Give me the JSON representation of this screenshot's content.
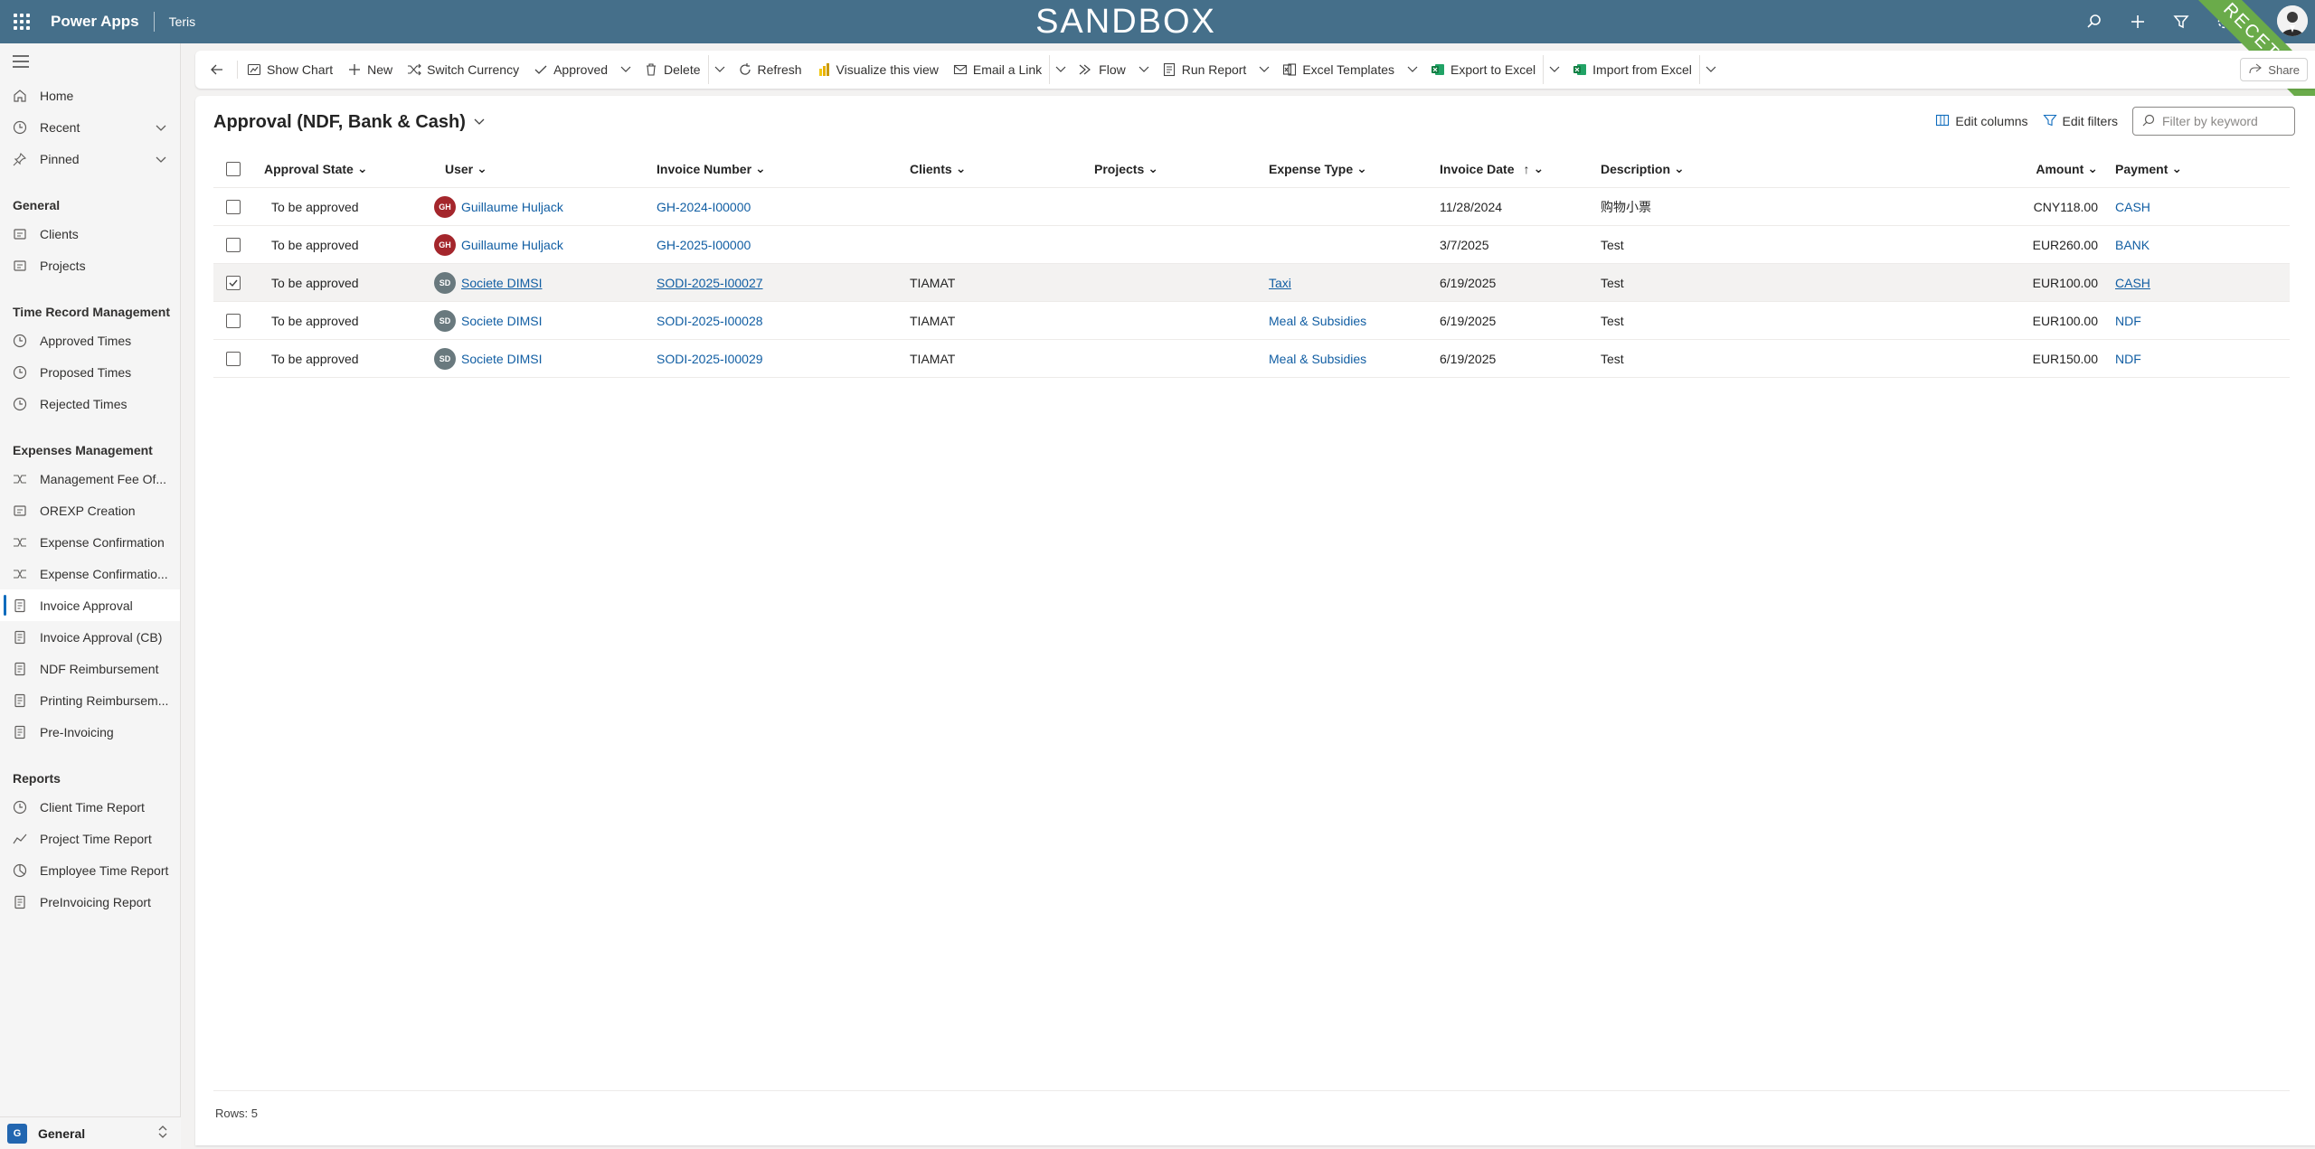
{
  "header": {
    "app_name": "Power Apps",
    "environment": "Teris",
    "banner": "SANDBOX",
    "ribbon": "RECETTE"
  },
  "sidebar": {
    "top_items": [
      {
        "label": "Home",
        "icon": "home-icon"
      },
      {
        "label": "Recent",
        "icon": "clock-icon",
        "expandable": true
      },
      {
        "label": "Pinned",
        "icon": "pin-icon",
        "expandable": true
      }
    ],
    "groups": [
      {
        "title": "General",
        "items": [
          {
            "label": "Clients",
            "icon": "document-icon"
          },
          {
            "label": "Projects",
            "icon": "document-icon"
          }
        ]
      },
      {
        "title": "Time Record Management",
        "items": [
          {
            "label": "Approved Times",
            "icon": "clock-icon"
          },
          {
            "label": "Proposed Times",
            "icon": "clock-icon"
          },
          {
            "label": "Rejected Times",
            "icon": "clock-icon"
          }
        ]
      },
      {
        "title": "Expenses Management",
        "items": [
          {
            "label": "Management Fee Of...",
            "icon": "flow-icon"
          },
          {
            "label": "OREXP Creation",
            "icon": "document-icon"
          },
          {
            "label": "Expense Confirmation",
            "icon": "flow-icon"
          },
          {
            "label": "Expense Confirmatio...",
            "icon": "flow-icon"
          },
          {
            "label": "Invoice Approval",
            "icon": "receipt-icon",
            "active": true
          },
          {
            "label": "Invoice Approval (CB)",
            "icon": "receipt-icon"
          },
          {
            "label": "NDF Reimbursement",
            "icon": "receipt-icon"
          },
          {
            "label": "Printing Reimbursem...",
            "icon": "receipt-icon"
          },
          {
            "label": "Pre-Invoicing",
            "icon": "receipt-icon"
          }
        ]
      },
      {
        "title": "Reports",
        "items": [
          {
            "label": "Client Time Report",
            "icon": "clock-icon"
          },
          {
            "label": "Project Time Report",
            "icon": "chart-line-icon"
          },
          {
            "label": "Employee Time Report",
            "icon": "pie-icon"
          },
          {
            "label": "PreInvoicing Report",
            "icon": "receipt-icon"
          }
        ]
      }
    ],
    "area": {
      "badge": "G",
      "label": "General"
    }
  },
  "commands": {
    "show_chart": "Show Chart",
    "new": "New",
    "switch_currency": "Switch Currency",
    "approved": "Approved",
    "delete": "Delete",
    "refresh": "Refresh",
    "visualize": "Visualize this view",
    "email_link": "Email a Link",
    "flow": "Flow",
    "run_report": "Run Report",
    "excel_templates": "Excel Templates",
    "export_excel": "Export to Excel",
    "import_excel": "Import from Excel",
    "share": "Share"
  },
  "view": {
    "title": "Approval (NDF, Bank & Cash)",
    "edit_columns": "Edit columns",
    "edit_filters": "Edit filters",
    "filter_placeholder": "Filter by keyword"
  },
  "grid": {
    "columns": {
      "approval_state": "Approval State",
      "user": "User",
      "invoice_number": "Invoice Number",
      "clients": "Clients",
      "projects": "Projects",
      "expense_type": "Expense Type",
      "invoice_date": "Invoice Date",
      "description": "Description",
      "amount": "Amount",
      "payment": "Payment"
    },
    "rows": [
      {
        "approval_state": "To be approved",
        "user_initials": "GH",
        "user_color": "#a4262c",
        "user": "Guillaume Huljack",
        "invoice_number": "GH-2024-I00000",
        "clients": "",
        "projects": "",
        "expense_type": "",
        "invoice_date": "11/28/2024",
        "description": "购物小票",
        "amount": "CNY118.00",
        "payment": "CASH",
        "selected": false
      },
      {
        "approval_state": "To be approved",
        "user_initials": "GH",
        "user_color": "#a4262c",
        "user": "Guillaume Huljack",
        "invoice_number": "GH-2025-I00000",
        "clients": "",
        "projects": "",
        "expense_type": "",
        "invoice_date": "3/7/2025",
        "description": "Test",
        "amount": "EUR260.00",
        "payment": "BANK",
        "selected": false
      },
      {
        "approval_state": "To be approved",
        "user_initials": "SD",
        "user_color": "#69797e",
        "user": "Societe DIMSI",
        "invoice_number": "SODI-2025-I00027",
        "clients": "TIAMAT",
        "projects": "",
        "expense_type": "Taxi",
        "invoice_date": "6/19/2025",
        "description": "Test",
        "amount": "EUR100.00",
        "payment": "CASH",
        "selected": true
      },
      {
        "approval_state": "To be approved",
        "user_initials": "SD",
        "user_color": "#69797e",
        "user": "Societe DIMSI",
        "invoice_number": "SODI-2025-I00028",
        "clients": "TIAMAT",
        "projects": "",
        "expense_type": "Meal & Subsidies",
        "invoice_date": "6/19/2025",
        "description": "Test",
        "amount": "EUR100.00",
        "payment": "NDF",
        "selected": false
      },
      {
        "approval_state": "To be approved",
        "user_initials": "SD",
        "user_color": "#69797e",
        "user": "Societe DIMSI",
        "invoice_number": "SODI-2025-I00029",
        "clients": "TIAMAT",
        "projects": "",
        "expense_type": "Meal & Subsidies",
        "invoice_date": "6/19/2025",
        "description": "Test",
        "amount": "EUR150.00",
        "payment": "NDF",
        "selected": false
      }
    ],
    "rows_label": "Rows: 5"
  }
}
